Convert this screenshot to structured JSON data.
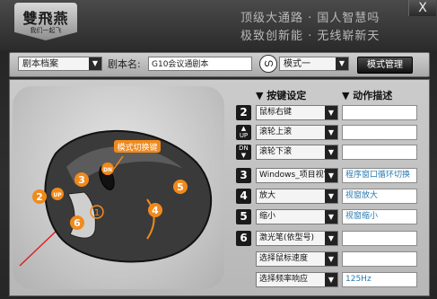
{
  "header": {
    "logo_main": "雙飛燕",
    "logo_sub": "我们一起飞",
    "slogan_line1": "顶级大通路 · 国人智慧吗",
    "slogan_line2": "极致创新能 · 无线崭新天",
    "close_label": "X"
  },
  "toolbar": {
    "profile_select": "剧本档案",
    "name_label": "剧本名:",
    "name_value": "G10会议通剧本",
    "mode_icon_glyph": "ഗ",
    "mode_select": "模式一",
    "mode_manage_label": "模式管理"
  },
  "mouse": {
    "callout_mode_switch": "模式切换键",
    "up_label": "UP",
    "dn_label": "DN",
    "markers": [
      "2",
      "3",
      "4",
      "5",
      "6",
      "1"
    ]
  },
  "table": {
    "col_key": "▼ 按键设定",
    "col_desc": "▼ 动作描述",
    "rows": [
      {
        "badge": "2",
        "action": "鼠标右键",
        "desc": ""
      },
      {
        "badge": "UP",
        "action": "滚轮上滚",
        "desc": ""
      },
      {
        "badge": "DN",
        "action": "滚轮下滚",
        "desc": ""
      },
      {
        "badge": "3",
        "action": "Windows_项目视窗",
        "desc": "程序窗口循环切换"
      },
      {
        "badge": "4",
        "action": "放大",
        "desc": "视窗放大"
      },
      {
        "badge": "5",
        "action": "缩小",
        "desc": "视窗缩小"
      },
      {
        "badge": "6",
        "action": "激光笔(依型号)",
        "desc": ""
      },
      {
        "badge": "",
        "action": "选择鼠标速度",
        "desc": ""
      },
      {
        "badge": "",
        "action": "选择频率响应",
        "desc": "125Hz"
      }
    ]
  },
  "colors": {
    "accent_orange": "#f08a1c",
    "desc_text": "#2a7ab0"
  }
}
